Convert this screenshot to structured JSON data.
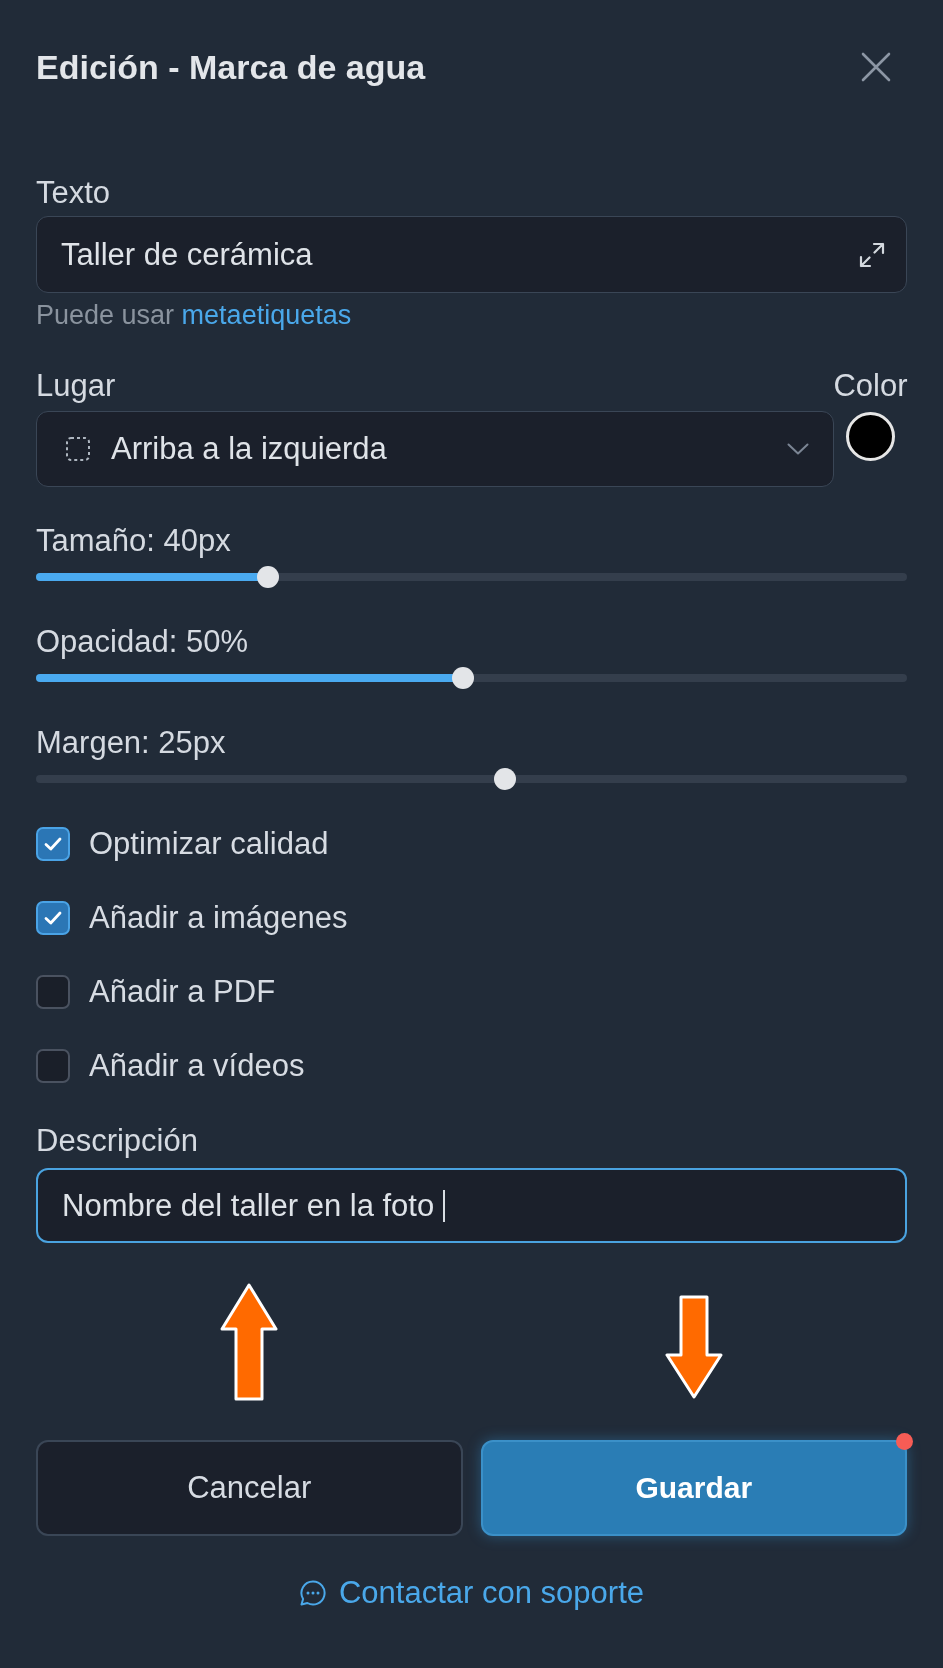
{
  "dialog": {
    "title": "Edición - Marca de agua"
  },
  "text_field": {
    "label": "Texto",
    "value": "Taller de cerámica",
    "focused": false
  },
  "help": {
    "text": "Puede usar",
    "link": "metaetiquetas"
  },
  "position": {
    "label": "Lugar",
    "value": "Arriba a la izquierda"
  },
  "color_picker": {
    "label": "Color",
    "color": "#000000"
  },
  "sliders": [
    {
      "label": "Tamaño: 40px",
      "level": 0.26,
      "filled": true
    },
    {
      "label": "Opacidad: 50%",
      "level": 0.49,
      "filled": true
    },
    {
      "label": "Margen: 25px",
      "level": 0.54,
      "filled": false
    }
  ],
  "options": [
    {
      "label": "Optimizar calidad",
      "checked": true
    },
    {
      "label": "Añadir a imágenes",
      "checked": true
    },
    {
      "label": "Añadir a PDF",
      "checked": false
    },
    {
      "label": "Añadir a vídeos",
      "checked": false
    }
  ],
  "description": {
    "label": "Descripción",
    "value": "Nombre del taller en la foto",
    "focused": true
  },
  "buttons": [
    {
      "label": "Cancelar",
      "kind": "secondary",
      "notification": false
    },
    {
      "label": "Guardar",
      "kind": "primary",
      "notification": true
    }
  ],
  "support_link": {
    "label": "Contactar con soporte"
  }
}
